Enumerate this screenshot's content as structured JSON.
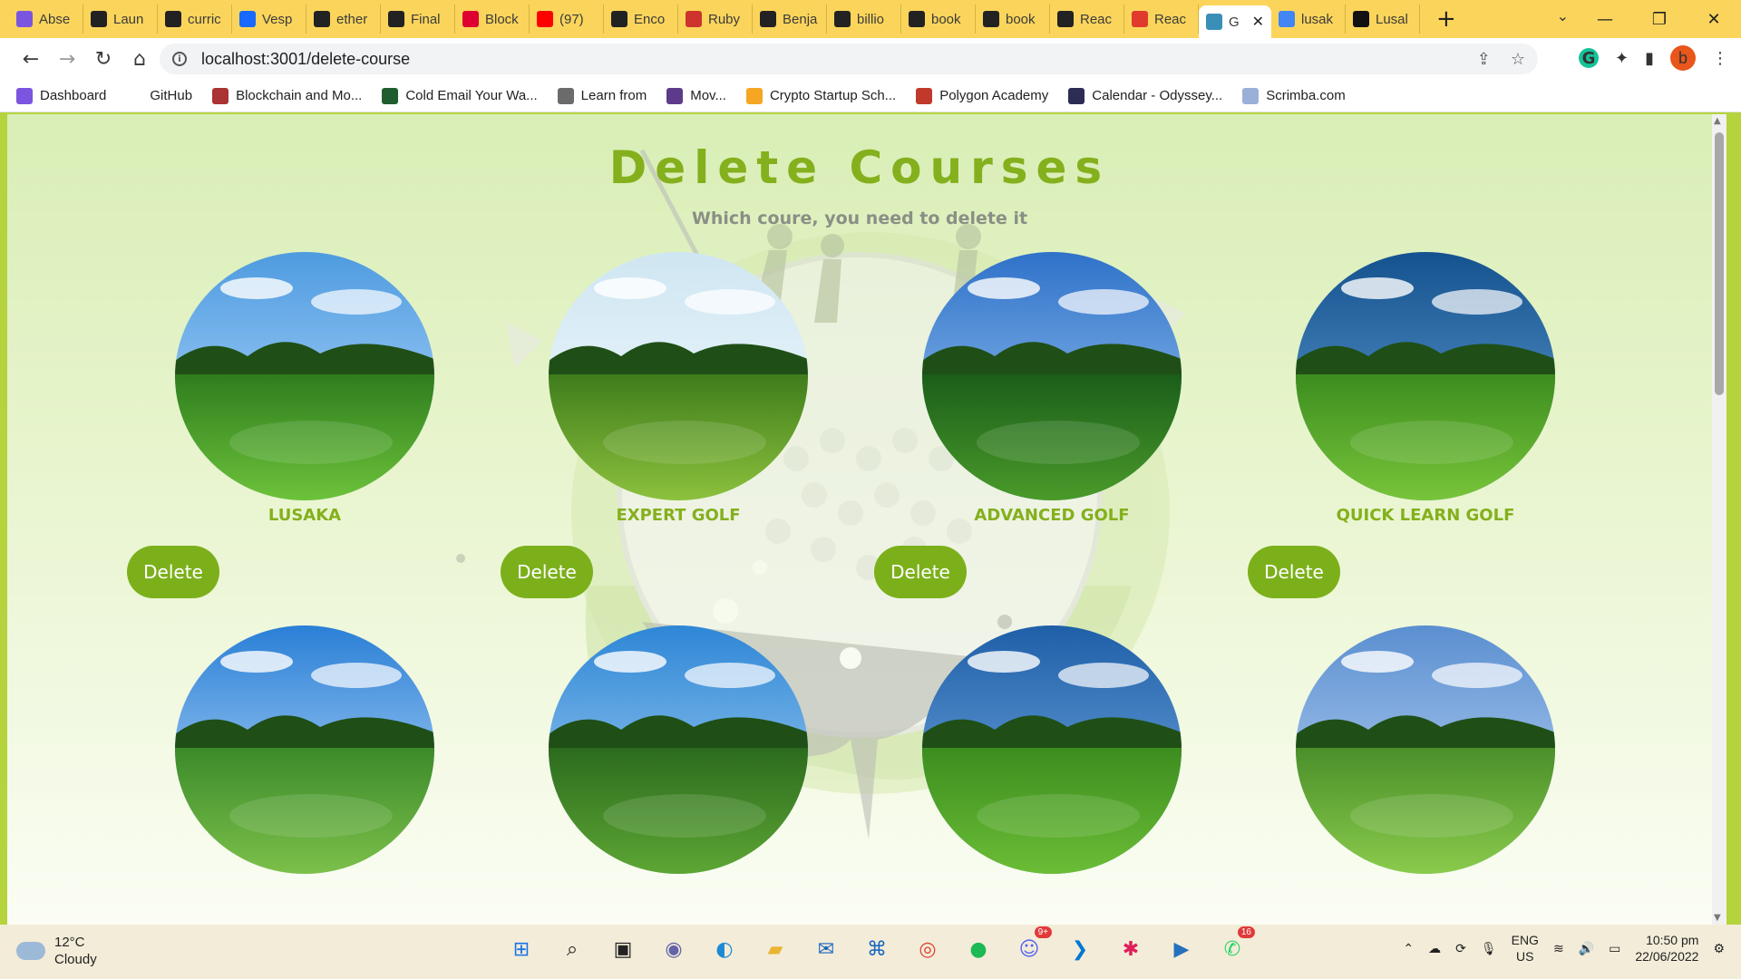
{
  "browser": {
    "tabs": [
      {
        "label": "Abse",
        "icon": "dashboard-icon",
        "color": "#7b55e0"
      },
      {
        "label": "Laun",
        "icon": "globe-icon",
        "color": "#222222"
      },
      {
        "label": "curric",
        "icon": "github-icon",
        "color": "#222222"
      },
      {
        "label": "Vesp",
        "icon": "behance-icon",
        "color": "#1769ff"
      },
      {
        "label": "ether",
        "icon": "github-icon",
        "color": "#222222"
      },
      {
        "label": "Final",
        "icon": "github-icon",
        "color": "#222222"
      },
      {
        "label": "Block",
        "icon": "angular-icon",
        "color": "#dd0031"
      },
      {
        "label": "(97)",
        "icon": "youtube-icon",
        "color": "#ff0000"
      },
      {
        "label": "Enco",
        "icon": "github-icon",
        "color": "#222222"
      },
      {
        "label": "Ruby",
        "icon": "ruby-icon",
        "color": "#cc342d"
      },
      {
        "label": "Benja",
        "icon": "github-icon",
        "color": "#222222"
      },
      {
        "label": "billio",
        "icon": "github-icon",
        "color": "#222222"
      },
      {
        "label": "book",
        "icon": "github-icon",
        "color": "#222222"
      },
      {
        "label": "book",
        "icon": "github-icon",
        "color": "#222222"
      },
      {
        "label": "Reac",
        "icon": "globe-icon",
        "color": "#222222"
      },
      {
        "label": "Reac",
        "icon": "vercel-icon",
        "color": "#e03a2f"
      },
      {
        "label": "G",
        "icon": "react-icon",
        "color": "#3a8fb7",
        "active": true
      },
      {
        "label": "lusak",
        "icon": "google-icon",
        "color": "#4285f4"
      },
      {
        "label": "Lusal",
        "icon": "site-icon",
        "color": "#111111"
      }
    ],
    "url": "localhost:3001/delete-course",
    "profile_initial": "b",
    "bookmarks": [
      {
        "label": "Dashboard",
        "color": "#7b55e0"
      },
      {
        "label": "GitHub",
        "color": "#ffffff"
      },
      {
        "label": "Blockchain and Mo...",
        "color": "#a33"
      },
      {
        "label": "Cold Email Your Wa...",
        "color": "#1f5d2e"
      },
      {
        "label": "Learn from",
        "color": "#6b6b6b"
      },
      {
        "label": "Mov...",
        "color": "#5d3b8a"
      },
      {
        "label": "Crypto Startup Sch...",
        "color": "#f5a623"
      },
      {
        "label": "Polygon Academy",
        "color": "#c0392b"
      },
      {
        "label": "Calendar - Odyssey...",
        "color": "#2c2c54"
      },
      {
        "label": "Scrimba.com",
        "color": "#9ab0d8"
      }
    ]
  },
  "page": {
    "title": "Delete Courses",
    "subtitle": "Which coure, you need to delete it",
    "delete_label": "Delete",
    "courses": [
      {
        "name": "LUSAKA"
      },
      {
        "name": "EXPERT GOLF"
      },
      {
        "name": "ADVANCED GOLF"
      },
      {
        "name": "QUICK LEARN GOLF"
      },
      {
        "name": ""
      },
      {
        "name": ""
      },
      {
        "name": ""
      },
      {
        "name": ""
      }
    ]
  },
  "taskbar": {
    "temp": "12°C",
    "condition": "Cloudy",
    "lang_top": "ENG",
    "lang_bottom": "US",
    "time": "10:50 pm",
    "date": "22/06/2022",
    "discord_badge": "9+",
    "whatsapp_badge": "16"
  }
}
